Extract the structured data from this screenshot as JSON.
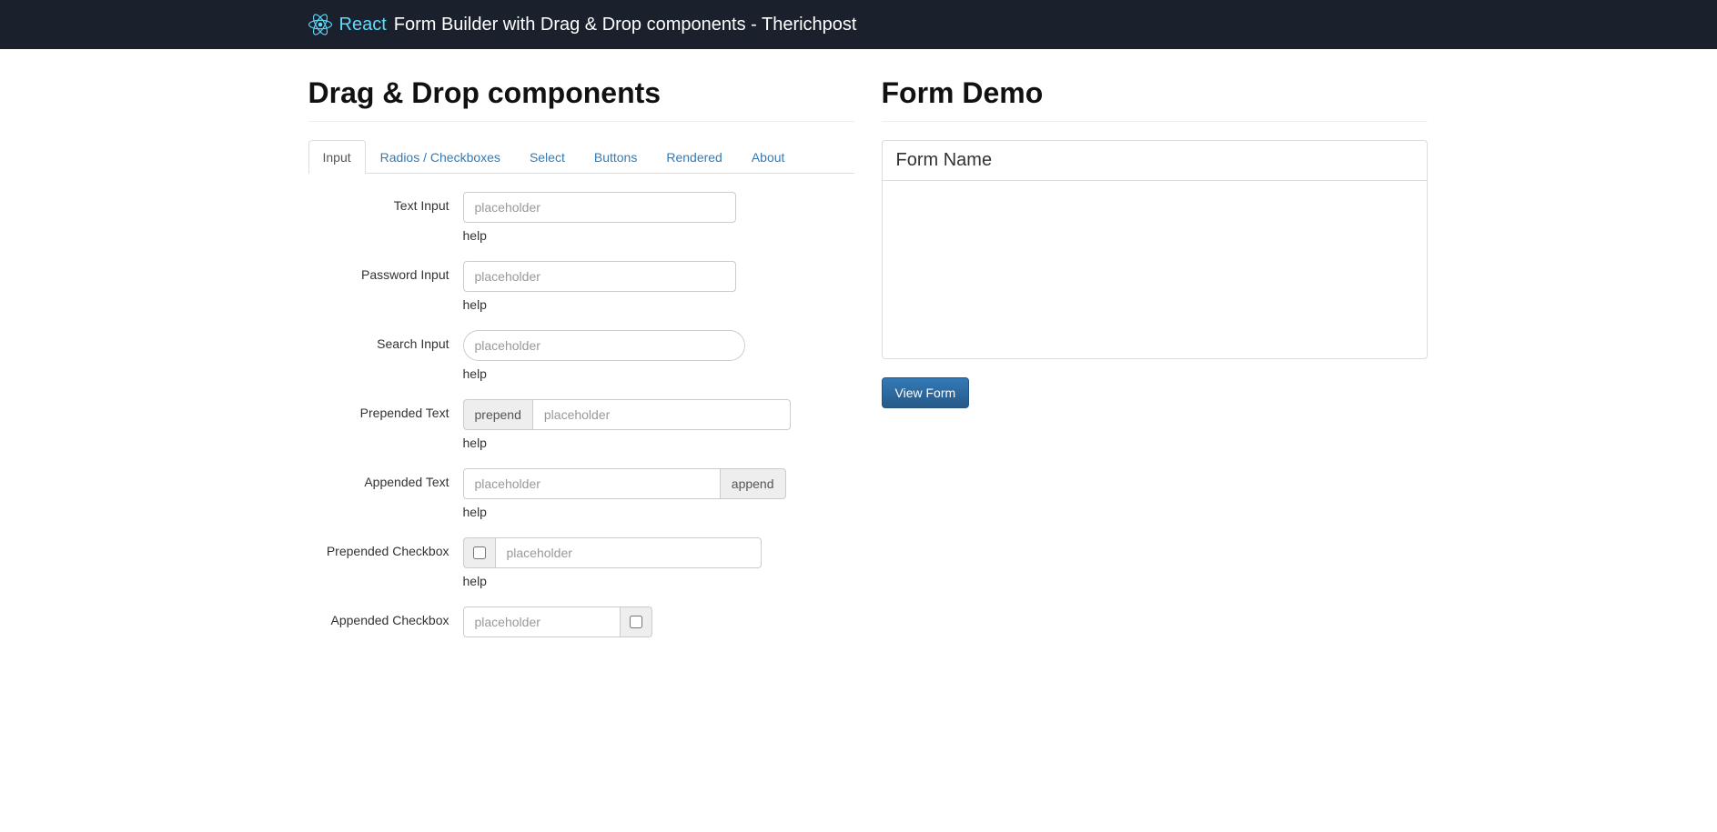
{
  "navbar": {
    "brand": "React",
    "title": "Form Builder with Drag & Drop components - Therichpost"
  },
  "left": {
    "heading": "Drag & Drop components",
    "tabs": [
      {
        "label": "Input",
        "active": true
      },
      {
        "label": "Radios / Checkboxes",
        "active": false
      },
      {
        "label": "Select",
        "active": false
      },
      {
        "label": "Buttons",
        "active": false
      },
      {
        "label": "Rendered",
        "active": false
      },
      {
        "label": "About",
        "active": false
      }
    ],
    "fields": {
      "text_input": {
        "label": "Text Input",
        "placeholder": "placeholder",
        "help": "help"
      },
      "password_input": {
        "label": "Password Input",
        "placeholder": "placeholder",
        "help": "help"
      },
      "search_input": {
        "label": "Search Input",
        "placeholder": "placeholder",
        "help": "help"
      },
      "prepended_text": {
        "label": "Prepended Text",
        "addon": "prepend",
        "placeholder": "placeholder",
        "help": "help"
      },
      "appended_text": {
        "label": "Appended Text",
        "addon": "append",
        "placeholder": "placeholder",
        "help": "help"
      },
      "prepended_checkbox": {
        "label": "Prepended Checkbox",
        "placeholder": "placeholder",
        "help": "help"
      },
      "appended_checkbox": {
        "label": "Appended Checkbox",
        "placeholder": "placeholder"
      }
    }
  },
  "right": {
    "heading": "Form Demo",
    "form_name": "Form Name",
    "view_form_label": "View Form"
  }
}
